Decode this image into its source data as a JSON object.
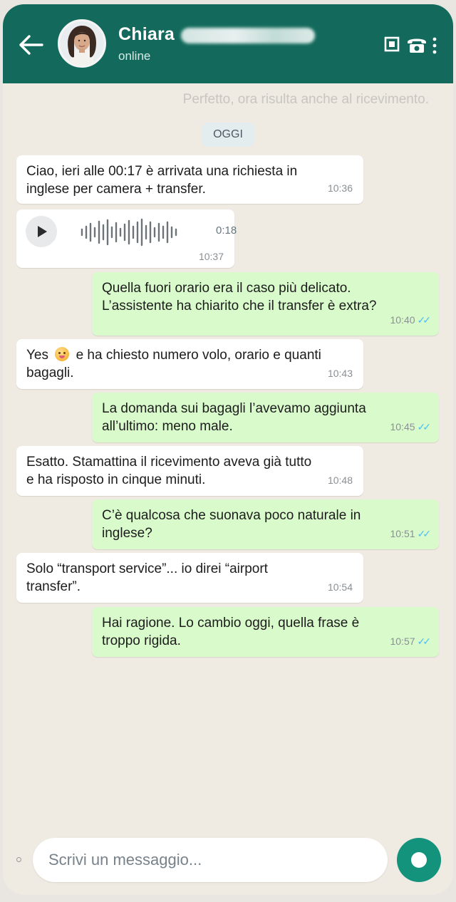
{
  "header": {
    "name": "Chiara",
    "status": "online",
    "bg_color": "#136a5c"
  },
  "chat": {
    "previous_message_faded": "Perfetto, ora risulta anche al ricevimento.",
    "date_chip": "OGGI",
    "messages": [
      {
        "dir": "in",
        "text": "Ciao, ieri alle 00:17 è arrivata una richiesta in\ninglese per camera + transfer.",
        "time": "10:36"
      },
      {
        "dir": "in",
        "type": "voice",
        "duration": "0:18",
        "time": "10:37"
      },
      {
        "dir": "out",
        "text": "Quella fuori orario era il caso più delicato.\nL’assistente ha chiarito che il transfer è extra?",
        "time": "10:40"
      },
      {
        "dir": "in",
        "text_before_emoji": "Yes",
        "text_after_emoji": "e ha chiesto numero volo, orario e quanti\nbagagli.",
        "emoji": "smiling-face-emoji",
        "time": "10:43"
      },
      {
        "dir": "out",
        "text": "La domanda sui bagagli l’avevamo aggiunta\nall’ultimo: meno male.",
        "time": "10:45"
      },
      {
        "dir": "in",
        "text": "Esatto. Stamattina il ricevimento aveva già tutto\ne ha risposto in cinque minuti.",
        "time": "10:48"
      },
      {
        "dir": "out",
        "text": "C’è qualcosa che suonava poco naturale in\ninglese?",
        "time": "10:51"
      },
      {
        "dir": "in",
        "text": "Solo “transport service”... io direi “airport\ntransfer”.",
        "time": "10:54"
      },
      {
        "dir": "out",
        "text": "Hai ragione. Lo cambio oggi, quella frase è\ntroppo rigida.",
        "time": "10:57"
      }
    ]
  },
  "composer": {
    "placeholder": "Scrivi un messaggio..."
  },
  "colors": {
    "outgoing_bubble": "#d9fbcc",
    "incoming_bubble": "#ffffff",
    "chat_bg": "#efeae2",
    "read_ticks": "#53bdeb",
    "mic_button": "#13937b"
  }
}
